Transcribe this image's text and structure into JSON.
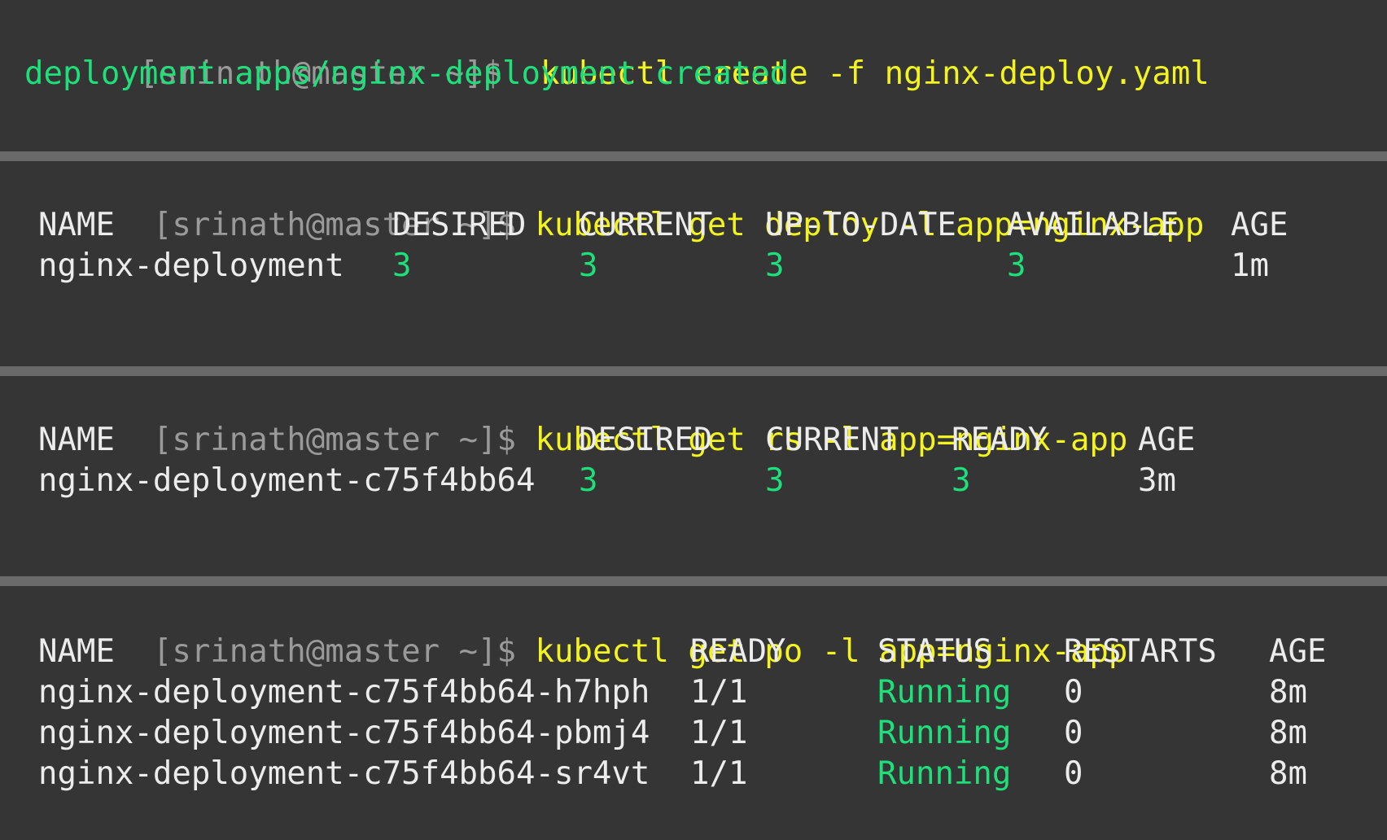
{
  "blocks": [
    {
      "prompt": "[srinath@master ~]$",
      "command": "kubectl create -f nginx-deploy.yaml",
      "output": "deployment.apps/nginx-deployment created"
    },
    {
      "prompt": "[srinath@master ~]$",
      "command": "kubectl get deploy -l app=nginx-app",
      "headers": [
        "NAME",
        "DESIRED",
        "CURRENT",
        "UP-TO-DATE",
        "AVAILABLE",
        "AGE"
      ],
      "rows": [
        [
          "nginx-deployment",
          "3",
          "3",
          "3",
          "3",
          "1m"
        ]
      ]
    },
    {
      "prompt": "[srinath@master ~]$",
      "command": "kubectl get rs -l app=nginx-app",
      "headers": [
        "NAME",
        "DESIRED",
        "CURRENT",
        "READY",
        "AGE"
      ],
      "rows": [
        [
          "nginx-deployment-c75f4bb64",
          "3",
          "3",
          "3",
          "3m"
        ]
      ]
    },
    {
      "prompt": "[srinath@master ~]$",
      "command": "kubectl get po -l app=nginx-app",
      "headers": [
        "NAME",
        "READY",
        "STATUS",
        "RESTARTS",
        "AGE"
      ],
      "rows": [
        [
          "nginx-deployment-c75f4bb64-h7hph",
          "1/1",
          "Running",
          "0",
          "8m"
        ],
        [
          "nginx-deployment-c75f4bb64-pbmj4",
          "1/1",
          "Running",
          "0",
          "8m"
        ],
        [
          "nginx-deployment-c75f4bb64-sr4vt",
          "1/1",
          "Running",
          "0",
          "8m"
        ]
      ]
    }
  ],
  "colors": {
    "background": "#353535",
    "separator": "#6a6a6a",
    "prompt": "#9a9a9a",
    "command": "#f3f31f",
    "success": "#1de07a",
    "text": "#ececec"
  }
}
